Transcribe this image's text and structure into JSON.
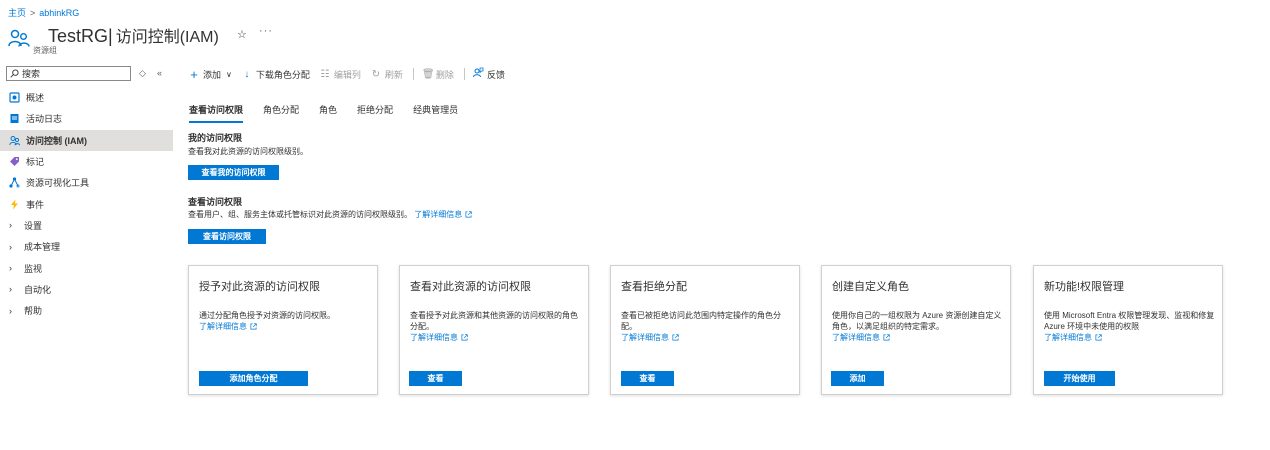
{
  "breadcrumb": {
    "home": "主页",
    "separator": ">",
    "current": "abhinkRG"
  },
  "header": {
    "resource_name": "TestRG",
    "separator": "|",
    "page_title": "访问控制(IAM)",
    "resource_type": "资源组",
    "favorite_icon": "star-icon",
    "more_label": "···"
  },
  "sidebar": {
    "search_placeholder": "搜索",
    "expand_label": "◇",
    "collapse_label": "«",
    "items": [
      {
        "label": "概述",
        "icon": "overview-icon",
        "color": "#0078d4"
      },
      {
        "label": "活动日志",
        "icon": "activity-log-icon",
        "color": "#0078d4"
      },
      {
        "label": "访问控制 (IAM)",
        "icon": "iam-icon",
        "color": "#0078d4",
        "active": true
      },
      {
        "label": "标记",
        "icon": "tag-icon",
        "color": "#8661c5"
      },
      {
        "label": "资源可视化工具",
        "icon": "visualizer-icon",
        "color": "#0078d4"
      },
      {
        "label": "事件",
        "icon": "events-icon",
        "color": "#ffb900"
      },
      {
        "label": "设置",
        "icon": "chevron-right-icon"
      },
      {
        "label": "成本管理",
        "icon": "chevron-right-icon"
      },
      {
        "label": "监视",
        "icon": "chevron-right-icon"
      },
      {
        "label": "自动化",
        "icon": "chevron-right-icon"
      },
      {
        "label": "帮助",
        "icon": "chevron-right-icon"
      }
    ]
  },
  "toolbar": {
    "add": "添加",
    "download": "下载角色分配",
    "edit_columns": "编辑列",
    "refresh": "刷新",
    "delete": "删除",
    "feedback": "反馈"
  },
  "tabs": [
    "查看访问权限",
    "角色分配",
    "角色",
    "拒绝分配",
    "经典管理员"
  ],
  "my_access": {
    "title": "我的访问权限",
    "description": "查看我对此资源的访问权限级别。",
    "button": "查看我的访问权限"
  },
  "check_access": {
    "title": "查看访问权限",
    "description": "查看用户、组、服务主体或托管标识对此资源的访问权限级别。",
    "link": "了解详细信息",
    "button": "查看访问权限"
  },
  "cards": [
    {
      "title": "授予对此资源的访问权限",
      "description": "通过分配角色授予对资源的访问权限。",
      "link": "了解详细信息",
      "button": "添加角色分配"
    },
    {
      "title": "查看对此资源的访问权限",
      "description": "查看授予对此资源和其他资源的访问权限的角色分配。",
      "link": "了解详细信息",
      "button": "查看"
    },
    {
      "title": "查看拒绝分配",
      "description": "查看已被拒绝访问此范围内特定操作的角色分配。",
      "link": "了解详细信息",
      "button": "查看"
    },
    {
      "title": "创建自定义角色",
      "description": "使用你自己的一组权限为 Azure 资源创建自定义角色，以满足组织的特定需求。",
      "link": "了解详细信息",
      "button": "添加"
    },
    {
      "title": "新功能!权限管理",
      "description": "使用 Microsoft Entra 权限管理发现、监视和修复 Azure 环境中未使用的权限",
      "link": "了解详细信息",
      "button": "开始使用"
    }
  ],
  "colors": {
    "accent": "#0078d4",
    "active_bg": "#e1dfdd"
  }
}
